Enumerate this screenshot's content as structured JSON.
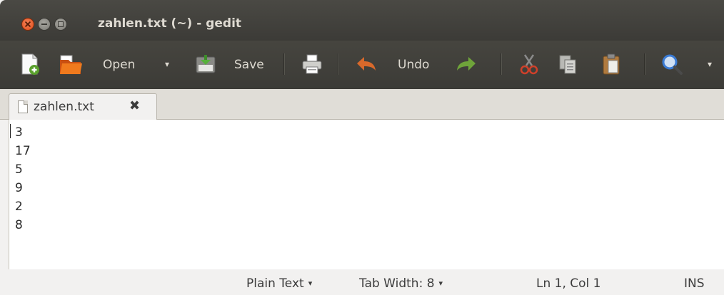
{
  "window": {
    "title": "zahlen.txt (~) - gedit"
  },
  "toolbar": {
    "open_label": "Open",
    "save_label": "Save",
    "undo_label": "Undo",
    "icons": [
      "new-document-icon",
      "open-folder-icon",
      "save-icon",
      "print-icon",
      "undo-icon",
      "redo-icon",
      "cut-icon",
      "copy-icon",
      "paste-icon",
      "search-icon"
    ]
  },
  "tabs": [
    {
      "label": "zahlen.txt",
      "close_glyph": "✖"
    }
  ],
  "editor": {
    "lines": [
      "3",
      "17",
      "5",
      "9",
      "2",
      "8"
    ]
  },
  "statusbar": {
    "language": "Plain Text",
    "tab_width": "Tab Width: 8",
    "position": "Ln 1, Col 1",
    "mode": "INS"
  },
  "colors": {
    "titlebar": "#3c3b37",
    "close_button": "#df4a16",
    "undo_arrow": "#d9692b",
    "redo_arrow": "#6fa43a",
    "search_icon": "#3a7bd5"
  }
}
